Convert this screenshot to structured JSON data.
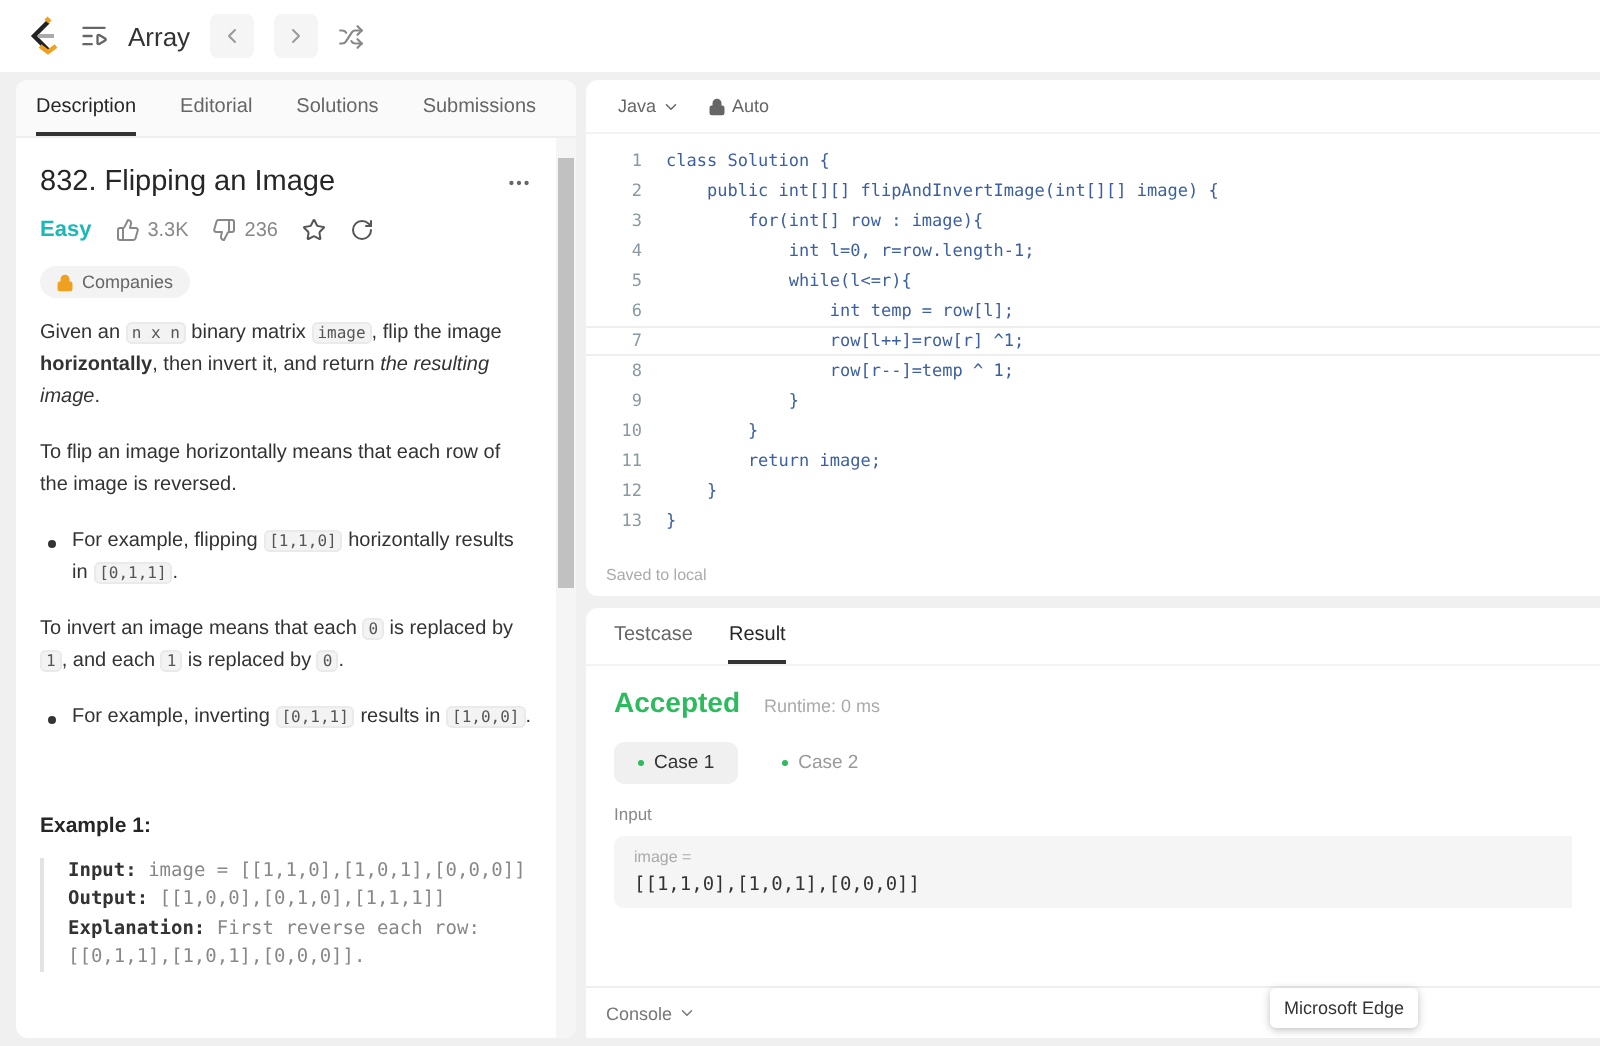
{
  "topbar": {
    "list_title": "Array"
  },
  "left_tabs": [
    {
      "label": "Description",
      "selected": true
    },
    {
      "label": "Editorial",
      "selected": false
    },
    {
      "label": "Solutions",
      "selected": false
    },
    {
      "label": "Submissions",
      "selected": false
    }
  ],
  "problem": {
    "title": "832. Flipping an Image",
    "difficulty": "Easy",
    "likes": "3.3K",
    "dislikes": "236",
    "companies": "Companies"
  },
  "description": [
    {
      "kind": "para",
      "parts": [
        {
          "kind": "text",
          "s": "Given an "
        },
        {
          "kind": "code",
          "s": "n x n"
        },
        {
          "kind": "text",
          "s": " binary matrix "
        },
        {
          "kind": "code",
          "s": "image"
        },
        {
          "kind": "text",
          "s": ", flip the image "
        },
        {
          "kind": "bold",
          "s": "horizontally"
        },
        {
          "kind": "text",
          "s": ", then invert it, and return "
        },
        {
          "kind": "italic",
          "s": "the resulting image"
        },
        {
          "kind": "text",
          "s": "."
        }
      ]
    },
    {
      "kind": "para",
      "parts": [
        {
          "kind": "text",
          "s": "To flip an image horizontally means that each row of the image is reversed."
        }
      ]
    },
    {
      "kind": "bullet",
      "parts": [
        {
          "kind": "text",
          "s": "For example, flipping "
        },
        {
          "kind": "code",
          "s": "[1,1,0]"
        },
        {
          "kind": "text",
          "s": " horizontally results in "
        },
        {
          "kind": "code",
          "s": "[0,1,1]"
        },
        {
          "kind": "text",
          "s": "."
        }
      ]
    },
    {
      "kind": "para",
      "parts": [
        {
          "kind": "text",
          "s": "To invert an image means that each "
        },
        {
          "kind": "code",
          "s": "0"
        },
        {
          "kind": "text",
          "s": " is replaced by "
        },
        {
          "kind": "code",
          "s": "1"
        },
        {
          "kind": "text",
          "s": ", and each "
        },
        {
          "kind": "code",
          "s": "1"
        },
        {
          "kind": "text",
          "s": " is replaced by "
        },
        {
          "kind": "code",
          "s": "0"
        },
        {
          "kind": "text",
          "s": "."
        }
      ]
    },
    {
      "kind": "bullet",
      "parts": [
        {
          "kind": "text",
          "s": "For example, inverting "
        },
        {
          "kind": "code",
          "s": "[0,1,1]"
        },
        {
          "kind": "text",
          "s": " results in "
        },
        {
          "kind": "code",
          "s": "[1,0,0]"
        },
        {
          "kind": "text",
          "s": "."
        }
      ]
    }
  ],
  "example": {
    "title": "Example 1:",
    "lines": [
      {
        "label": "Input:",
        "value": "image = [[1,1,0],[1,0,1],[0,0,0]]"
      },
      {
        "label": "Output:",
        "value": "[[1,0,0],[0,1,0],[1,1,1]]"
      },
      {
        "label": "Explanation:",
        "value": "First reverse each row: [[0,1,1],[1,0,1],[0,0,0]]."
      }
    ]
  },
  "editor": {
    "language": "Java",
    "mode": "Auto",
    "status": "Saved to local",
    "lines": [
      {
        "n": "1",
        "code": "class Solution {",
        "selected": false
      },
      {
        "n": "2",
        "code": "    public int[][] flipAndInvertImage(int[][] image) {",
        "selected": false
      },
      {
        "n": "3",
        "code": "        for(int[] row : image){",
        "selected": false
      },
      {
        "n": "4",
        "code": "            int l=0, r=row.length-1;",
        "selected": false
      },
      {
        "n": "5",
        "code": "            while(l<=r){",
        "selected": false
      },
      {
        "n": "6",
        "code": "                int temp = row[l];",
        "selected": false
      },
      {
        "n": "7",
        "code": "                row[l++]=row[r] ^1;",
        "selected": true
      },
      {
        "n": "8",
        "code": "                row[r--]=temp ^ 1;",
        "selected": false
      },
      {
        "n": "9",
        "code": "            }",
        "selected": false
      },
      {
        "n": "10",
        "code": "        }",
        "selected": false
      },
      {
        "n": "11",
        "code": "        return image;",
        "selected": false
      },
      {
        "n": "12",
        "code": "    }",
        "selected": false
      },
      {
        "n": "13",
        "code": "}",
        "selected": false
      }
    ]
  },
  "result_tabs": [
    {
      "label": "Testcase",
      "selected": false
    },
    {
      "label": "Result",
      "selected": true
    }
  ],
  "result": {
    "verdict": "Accepted",
    "runtime": "Runtime: 0 ms",
    "cases": [
      {
        "label": "Case 1",
        "selected": true
      },
      {
        "label": "Case 2",
        "selected": false
      }
    ],
    "input_label": "Input",
    "var_name": "image =",
    "var_value": "[[1,1,0],[1,0,1],[0,0,0]]"
  },
  "console": "Console",
  "tooltip": "Microsoft Edge"
}
